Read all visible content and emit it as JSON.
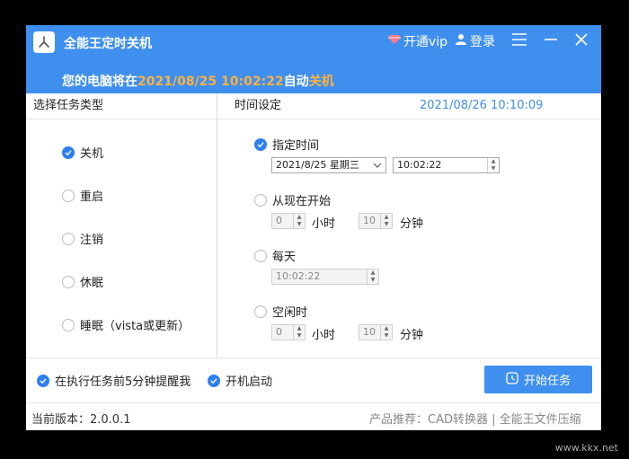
{
  "header": {
    "title": "全能王定时关机",
    "vip_label": "开通vip",
    "login_label": "登录",
    "status_prefix": "您的电脑将在",
    "status_time": "2021/08/25 10:02:22",
    "status_mid": "自动",
    "status_action": "关机"
  },
  "columns": {
    "task_type": "选择任务类型",
    "time_setting": "时间设定",
    "current_time": "2021/08/26 10:10:09"
  },
  "tasks": [
    {
      "label": "关机",
      "checked": true
    },
    {
      "label": "重启",
      "checked": false
    },
    {
      "label": "注销",
      "checked": false
    },
    {
      "label": "休眠",
      "checked": false
    },
    {
      "label": "睡眠（vista或更新）",
      "checked": false
    }
  ],
  "time": {
    "specified": {
      "label": "指定时间",
      "date": "2021/8/25  星期三",
      "time": "10:02:22"
    },
    "from_now": {
      "label": "从现在开始",
      "hours": "0",
      "hours_unit": "小时",
      "minutes": "10",
      "minutes_unit": "分钟"
    },
    "daily": {
      "label": "每天",
      "time": "10:02:22"
    },
    "idle": {
      "label": "空闲时",
      "hours": "0",
      "hours_unit": "小时",
      "minutes": "10",
      "minutes_unit": "分钟"
    }
  },
  "options": {
    "remind_label": "在执行任务前5分钟提醒我",
    "boot_label": "开机启动",
    "start_button": "开始任务"
  },
  "footer": {
    "version": "当前版本：2.0.0.1",
    "recommend": "产品推荐：CAD转换器 | 全能王文件压缩"
  },
  "watermark": "www.kkx.net",
  "colors": {
    "accent": "#3f8fee",
    "highlight": "#ffb240"
  }
}
